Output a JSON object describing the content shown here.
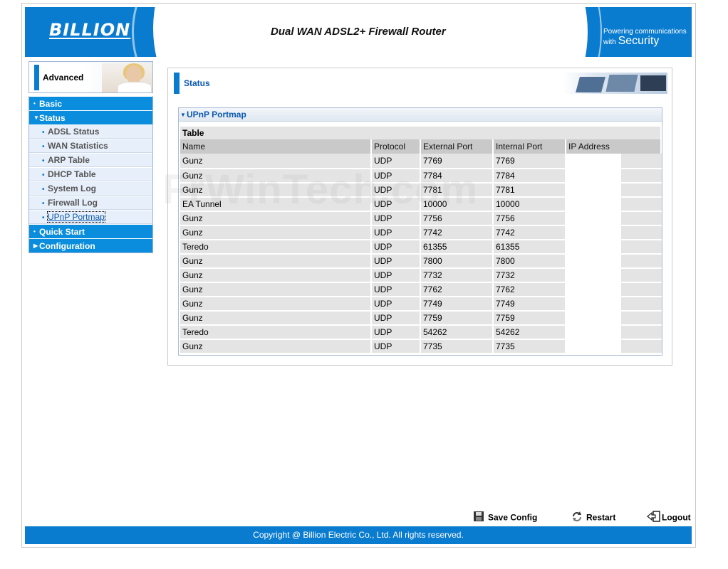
{
  "header": {
    "logo": "BILLION",
    "product_title": "Dual WAN ADSL2+ Firewall Router",
    "tagline_top": "Powering communications",
    "tagline_bottom_small": "with",
    "tagline_bottom_big": "Security"
  },
  "sidebar": {
    "mode_label": "Advanced",
    "items": [
      {
        "label": "Basic",
        "type": "main",
        "marker": "•",
        "expanded": false
      },
      {
        "label": "Status",
        "type": "main",
        "marker": "▼",
        "expanded": true
      },
      {
        "label": "ADSL Status",
        "type": "sub"
      },
      {
        "label": "WAN Statistics",
        "type": "sub"
      },
      {
        "label": "ARP Table",
        "type": "sub"
      },
      {
        "label": "DHCP Table",
        "type": "sub"
      },
      {
        "label": "System Log",
        "type": "sub"
      },
      {
        "label": "Firewall Log",
        "type": "sub"
      },
      {
        "label": "UPnP Portmap",
        "type": "sub",
        "active": true
      },
      {
        "label": "Quick Start",
        "type": "main",
        "marker": "•"
      },
      {
        "label": "Configuration",
        "type": "main",
        "marker": "▶"
      }
    ]
  },
  "main": {
    "section_title": "Status",
    "panel_title": "UPnP Portmap",
    "table_caption": "Table",
    "columns": [
      "Name",
      "Protocol",
      "External Port",
      "Internal Port",
      "IP Address"
    ],
    "rows": [
      {
        "name": "Gunz",
        "protocol": "UDP",
        "external": "7769",
        "internal": "7769",
        "ip": ""
      },
      {
        "name": "Gunz",
        "protocol": "UDP",
        "external": "7784",
        "internal": "7784",
        "ip": ""
      },
      {
        "name": "Gunz",
        "protocol": "UDP",
        "external": "7781",
        "internal": "7781",
        "ip": ""
      },
      {
        "name": "EA Tunnel",
        "protocol": "UDP",
        "external": "10000",
        "internal": "10000",
        "ip": ""
      },
      {
        "name": "Gunz",
        "protocol": "UDP",
        "external": "7756",
        "internal": "7756",
        "ip": ""
      },
      {
        "name": "Gunz",
        "protocol": "UDP",
        "external": "7742",
        "internal": "7742",
        "ip": ""
      },
      {
        "name": "Teredo",
        "protocol": "UDP",
        "external": "61355",
        "internal": "61355",
        "ip": ""
      },
      {
        "name": "Gunz",
        "protocol": "UDP",
        "external": "7800",
        "internal": "7800",
        "ip": ""
      },
      {
        "name": "Gunz",
        "protocol": "UDP",
        "external": "7732",
        "internal": "7732",
        "ip": ""
      },
      {
        "name": "Gunz",
        "protocol": "UDP",
        "external": "7762",
        "internal": "7762",
        "ip": ""
      },
      {
        "name": "Gunz",
        "protocol": "UDP",
        "external": "7749",
        "internal": "7749",
        "ip": ""
      },
      {
        "name": "Gunz",
        "protocol": "UDP",
        "external": "7759",
        "internal": "7759",
        "ip": ""
      },
      {
        "name": "Teredo",
        "protocol": "UDP",
        "external": "54262",
        "internal": "54262",
        "ip": ""
      },
      {
        "name": "Gunz",
        "protocol": "UDP",
        "external": "7735",
        "internal": "7735",
        "ip": ""
      }
    ]
  },
  "toolbar": {
    "save_label": "Save Config",
    "restart_label": "Restart",
    "logout_label": "Logout"
  },
  "watermark": "FrWinTech.com",
  "footer": {
    "copyright": "Copyright @ Billion Electric Co., Ltd. All rights reserved."
  },
  "colors": {
    "brand_blue": "#0a7ccf",
    "nav_blue": "#0a8ddd",
    "sub_item_bg": "#e7effa",
    "table_header_bg": "#c9c9c9",
    "table_cell_bg": "#e4e4e4"
  }
}
